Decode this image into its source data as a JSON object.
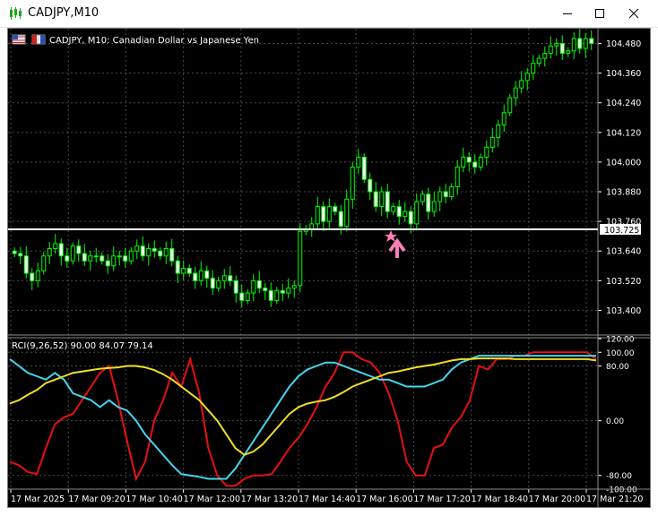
{
  "window": {
    "title": "CADJPY,M10",
    "minimize_icon": "minimize-icon",
    "maximize_icon": "maximize-icon",
    "close_icon": "close-icon"
  },
  "chart_header": {
    "symbol_info": "CADJPY, M10:  Canadian Dollar vs Japanese Yen"
  },
  "colors": {
    "background": "#000000",
    "grid": "#4a4a4a",
    "bull_candle": "#00ff00",
    "bear_candle_fill": "#ffffff",
    "price_line": "#ffffff",
    "rci_short": "#e81010",
    "rci_mid": "#40d8f0",
    "rci_long": "#f0e020",
    "arrow": "#ff7eb9"
  },
  "price_axis": {
    "ticks": [
      "104.480",
      "104.360",
      "104.240",
      "104.120",
      "104.000",
      "103.880",
      "103.760",
      "103.640",
      "103.520",
      "103.400"
    ],
    "current_price": "103.725"
  },
  "indicator": {
    "label": "RCI(9,26,52) 90.00 84.07 79.14",
    "ticks": [
      "120.00",
      "100.00",
      "80.00",
      "0.00",
      "-80.00",
      "-100.00"
    ]
  },
  "time_axis": {
    "labels": [
      "17 Mar 2025",
      "17 Mar 09:20",
      "17 Mar 10:40",
      "17 Mar 12:00",
      "17 Mar 13:20",
      "17 Mar 14:40",
      "17 Mar 16:00",
      "17 Mar 17:20",
      "17 Mar 18:40",
      "17 Mar 20:00",
      "17 Mar 21:20"
    ]
  },
  "chart_data": {
    "type": "candlestick",
    "symbol": "CADJPY",
    "timeframe": "M10",
    "title": "CADJPY, M10:  Canadian Dollar vs Japanese Yen",
    "ylim": [
      103.3,
      104.54
    ],
    "price_close_series": [
      103.63,
      103.62,
      103.55,
      103.52,
      103.56,
      103.62,
      103.65,
      103.67,
      103.62,
      103.6,
      103.66,
      103.63,
      103.6,
      103.62,
      103.62,
      103.6,
      103.58,
      103.62,
      103.62,
      103.6,
      103.64,
      103.66,
      103.62,
      103.65,
      103.64,
      103.62,
      103.65,
      103.6,
      103.55,
      103.57,
      103.55,
      103.52,
      103.56,
      103.53,
      103.49,
      103.52,
      103.54,
      103.52,
      103.47,
      103.44,
      103.47,
      103.52,
      103.49,
      103.48,
      103.44,
      103.48,
      103.47,
      103.49,
      103.5,
      103.72,
      103.73,
      103.75,
      103.82,
      103.76,
      103.82,
      103.8,
      103.74,
      103.85,
      103.98,
      104.02,
      103.93,
      103.88,
      103.82,
      103.88,
      103.8,
      103.82,
      103.78,
      103.8,
      103.75,
      103.84,
      103.87,
      103.8,
      103.84,
      103.88,
      103.86,
      103.9,
      103.98,
      104.02,
      104.0,
      103.98,
      104.02,
      104.06,
      104.1,
      104.15,
      104.2,
      104.26,
      104.3,
      104.33,
      104.36,
      104.4,
      104.42,
      104.44,
      104.47,
      104.48,
      104.44,
      104.45,
      104.5,
      104.46,
      104.5,
      104.48
    ],
    "current_price": 103.725,
    "signal_arrow": "up",
    "indicator": {
      "name": "RCI(9,26,52)",
      "ylim": [
        -100,
        120
      ],
      "levels": [
        100,
        80,
        0,
        -80,
        -100
      ],
      "series": [
        {
          "name": "RCI 9",
          "value": 90.0,
          "values": [
            -60,
            -65,
            -75,
            -78,
            -40,
            -5,
            5,
            10,
            30,
            50,
            70,
            80,
            30,
            -30,
            -85,
            -60,
            0,
            30,
            70,
            50,
            90,
            40,
            -40,
            -80,
            -95,
            -95,
            -85,
            -80,
            -80,
            -78,
            -60,
            -40,
            -25,
            -5,
            20,
            50,
            70,
            100,
            100,
            90,
            85,
            70,
            40,
            0,
            -60,
            -80,
            -80,
            -40,
            -35,
            -10,
            5,
            30,
            80,
            75,
            90,
            90,
            95,
            95,
            100,
            100,
            100,
            100,
            100,
            100,
            100,
            90
          ]
        },
        {
          "name": "RCI 26",
          "value": 84.07,
          "values": [
            90,
            80,
            70,
            65,
            60,
            70,
            60,
            40,
            35,
            30,
            20,
            30,
            20,
            15,
            0,
            -20,
            -35,
            -50,
            -65,
            -78,
            -80,
            -82,
            -85,
            -85,
            -85,
            -70,
            -50,
            -30,
            -10,
            10,
            30,
            50,
            65,
            75,
            80,
            85,
            85,
            80,
            75,
            70,
            65,
            60,
            60,
            55,
            50,
            50,
            50,
            55,
            60,
            75,
            85,
            90,
            95,
            95,
            95,
            95,
            95,
            95,
            95,
            95,
            95,
            95,
            95,
            95,
            95,
            95
          ]
        },
        {
          "name": "RCI 52",
          "value": 79.14,
          "values": [
            25,
            30,
            38,
            45,
            55,
            60,
            65,
            70,
            72,
            74,
            76,
            77,
            78,
            80,
            80,
            78,
            74,
            68,
            60,
            50,
            40,
            30,
            15,
            0,
            -20,
            -40,
            -50,
            -45,
            -35,
            -20,
            -5,
            10,
            20,
            25,
            28,
            30,
            35,
            42,
            50,
            55,
            60,
            65,
            70,
            72,
            75,
            78,
            80,
            82,
            85,
            88,
            90,
            90,
            91,
            91,
            91,
            91,
            90,
            90,
            90,
            90,
            90,
            90,
            90,
            90,
            90,
            88
          ]
        }
      ]
    },
    "x_labels": [
      "17 Mar 2025",
      "17 Mar 09:20",
      "17 Mar 10:40",
      "17 Mar 12:00",
      "17 Mar 13:20",
      "17 Mar 14:40",
      "17 Mar 16:00",
      "17 Mar 17:20",
      "17 Mar 18:40",
      "17 Mar 20:00",
      "17 Mar 21:20"
    ]
  }
}
